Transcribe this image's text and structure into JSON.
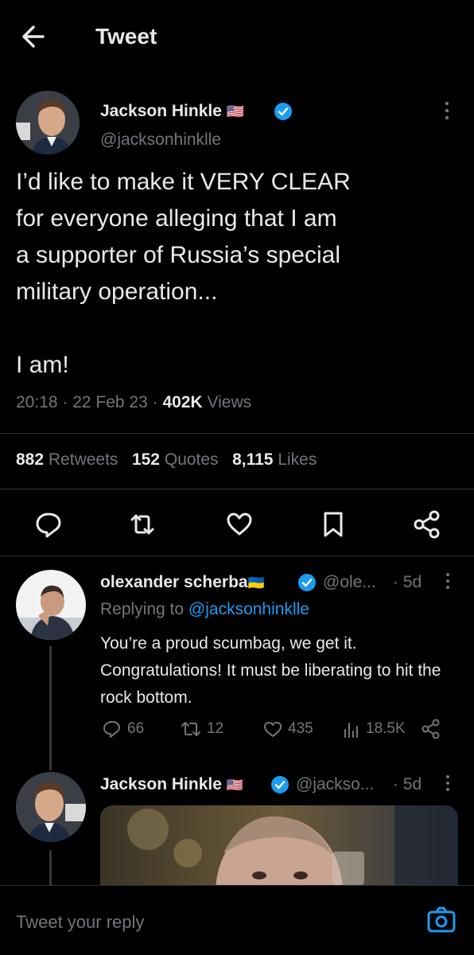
{
  "header": {
    "title": "Tweet"
  },
  "tweet": {
    "author_name": "Jackson Hinkle",
    "author_flag": "🇺🇸",
    "author_handle": "@jacksonhinklle",
    "text": "I’d like to make it VERY CLEAR\nfor everyone alleging that I am\na supporter of Russia’s special\nmilitary operation...\n\nI am!",
    "time": "20:18 · 22 Feb 23 · ",
    "views_count": "402K",
    "views_label": " Views",
    "retweets_count": "882",
    "retweets_label": "Retweets",
    "quotes_count": "152",
    "quotes_label": "Quotes",
    "likes_count": "8,115",
    "likes_label": "Likes"
  },
  "reply1": {
    "author_name": "olexander scherba",
    "author_flag": "🇺🇦",
    "author_handle": "@ole...",
    "age": "· 5d",
    "replying_prefix": "Replying to ",
    "replying_handle": "@jacksonhinklle",
    "text": "You’re a proud scumbag, we get it. Congratulations! It must be liberating to hit the rock bottom.",
    "replies": "66",
    "retweets": "12",
    "likes": "435",
    "views": "18.5K"
  },
  "reply2": {
    "author_name": "Jackson Hinkle",
    "author_flag": "🇺🇸",
    "author_handle": "@jackso...",
    "age": "· 5d"
  },
  "reply_bar": {
    "placeholder": "Tweet your reply"
  },
  "colors": {
    "accent": "#1d9bf0",
    "background": "#000000",
    "text": "#e7e9ea",
    "muted": "#71767b"
  }
}
